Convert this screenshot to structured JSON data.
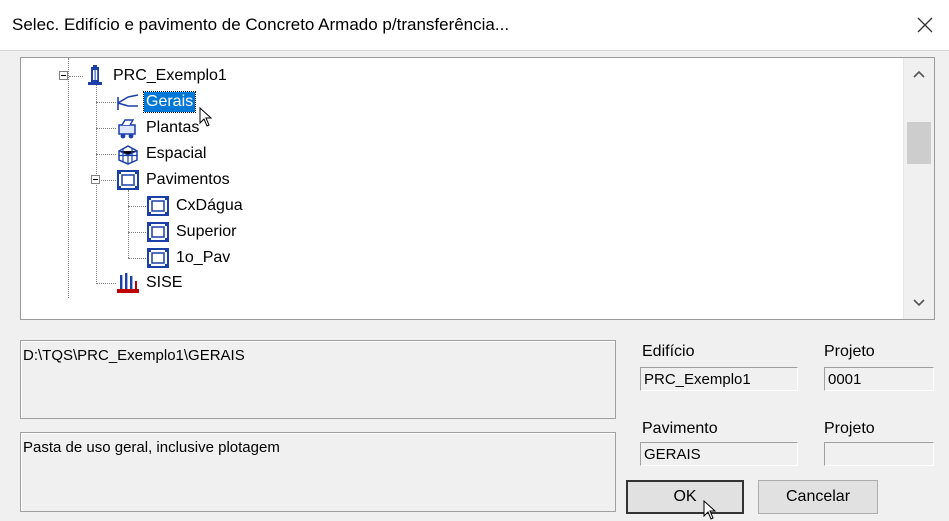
{
  "window": {
    "title": "Selec. Edifício e pavimento de Concreto Armado p/transferência..."
  },
  "tree": {
    "root": {
      "label": "PRC_Exemplo1",
      "icon": "building-icon"
    },
    "children": [
      {
        "label": "Gerais",
        "icon": "gerais-icon",
        "selected": true
      },
      {
        "label": "Plantas",
        "icon": "plotter-icon"
      },
      {
        "label": "Espacial",
        "icon": "spatial-frame-icon"
      },
      {
        "label": "Pavimentos",
        "icon": "floor-plan-icon"
      },
      {
        "label": "SISE",
        "icon": "sise-foundation-icon"
      }
    ],
    "pavimentos": [
      {
        "label": "CxDágua",
        "icon": "floor-plan-icon"
      },
      {
        "label": "Superior",
        "icon": "floor-plan-icon"
      },
      {
        "label": "1o_Pav",
        "icon": "floor-plan-icon"
      }
    ]
  },
  "path_text": "D:\\TQS\\PRC_Exemplo1\\GERAIS",
  "description_text": "Pasta de uso geral, inclusive plotagem",
  "edificio": {
    "label": "Edifício",
    "value": "PRC_Exemplo1"
  },
  "projeto1": {
    "label": "Projeto",
    "value": "0001"
  },
  "pavimento": {
    "label": "Pavimento",
    "value": "GERAIS"
  },
  "projeto2": {
    "label": "Projeto",
    "value": ""
  },
  "buttons": {
    "ok": "OK",
    "cancel": "Cancelar"
  }
}
